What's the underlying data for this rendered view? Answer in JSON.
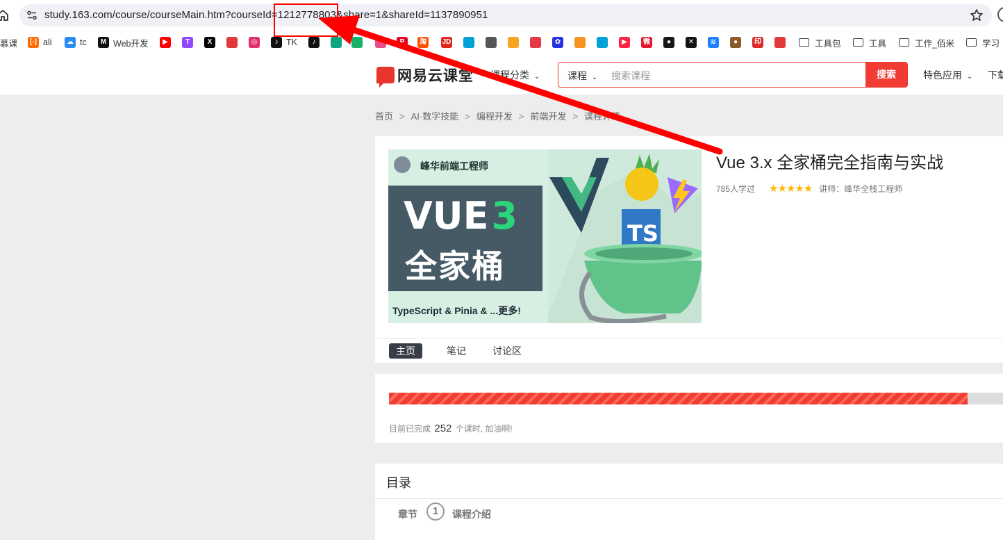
{
  "browser": {
    "url": "study.163.com/course/courseMain.htm?courseId=1212778803&share=1&shareId=1137890951",
    "bookmarks": [
      {
        "label": "慕课",
        "icon": "mooc-icon",
        "color": "#ffffff"
      },
      {
        "label": "ali",
        "icon": "aliyun-icon",
        "color": "#ff6a00"
      },
      {
        "label": "tc",
        "icon": "tencent-cloud-icon",
        "color": "#2a8cf2"
      },
      {
        "label": "Web开发",
        "icon": "mdn-icon",
        "color": "#111111"
      },
      {
        "label": "",
        "icon": "youtube-icon",
        "color": "#ff0000"
      },
      {
        "label": "",
        "icon": "twitch-icon",
        "color": "#9146ff"
      },
      {
        "label": "",
        "icon": "x-icon",
        "color": "#000000"
      },
      {
        "label": "",
        "icon": "bookmark-red-icon",
        "color": "#e03a3a"
      },
      {
        "label": "",
        "icon": "instagram-icon",
        "color": "#e1306c"
      },
      {
        "label": "TK",
        "icon": "tiktok-icon",
        "color": "#111111"
      },
      {
        "label": "",
        "icon": "tiktok-icon",
        "color": "#111111"
      },
      {
        "label": "",
        "icon": "chatgpt-icon",
        "color": "#10a37f"
      },
      {
        "label": "",
        "icon": "green-app-icon",
        "color": "#17b26a"
      },
      {
        "label": "",
        "icon": "dribbble-icon",
        "color": "#ea4c89"
      },
      {
        "label": "",
        "icon": "pinterest-icon",
        "color": "#e60023"
      },
      {
        "label": "",
        "icon": "taobao-icon",
        "color": "#ff5000"
      },
      {
        "label": "",
        "icon": "jd-icon",
        "color": "#e1251b"
      },
      {
        "label": "",
        "icon": "bilibili-icon",
        "color": "#00a1d6"
      },
      {
        "label": "",
        "icon": "bird-icon",
        "color": "#555555"
      },
      {
        "label": "",
        "icon": "smile-icon",
        "color": "#f5a623"
      },
      {
        "label": "",
        "icon": "red-logo-icon",
        "color": "#e63946"
      },
      {
        "label": "",
        "icon": "baidu-icon",
        "color": "#2932e1"
      },
      {
        "label": "",
        "icon": "orange-app-icon",
        "color": "#f7931e"
      },
      {
        "label": "",
        "icon": "bilibili-icon",
        "color": "#00a1d6"
      },
      {
        "label": "",
        "icon": "play-icon",
        "color": "#ff2442"
      },
      {
        "label": "",
        "icon": "weibo-icon",
        "color": "#e6162d"
      },
      {
        "label": "",
        "icon": "github-icon",
        "color": "#181717"
      },
      {
        "label": "",
        "icon": "close-circle-icon",
        "color": "#111111"
      },
      {
        "label": "",
        "icon": "layers-icon",
        "color": "#1e80ff"
      },
      {
        "label": "",
        "icon": "acorn-icon",
        "color": "#8b5a2b"
      },
      {
        "label": "",
        "icon": "seal-icon",
        "color": "#d92b2b"
      },
      {
        "label": "",
        "icon": "red-badge-icon",
        "color": "#e03a3a"
      },
      {
        "label": "工具包",
        "icon": "folder-icon",
        "color": "#444444"
      },
      {
        "label": "工具",
        "icon": "folder-icon",
        "color": "#444444"
      },
      {
        "label": "工作_佰米",
        "icon": "folder-icon",
        "color": "#444444"
      },
      {
        "label": "学习",
        "icon": "folder-icon",
        "color": "#444444"
      }
    ]
  },
  "header": {
    "logo_text": "网易云课堂",
    "category_label": "课程分类",
    "search_type": "课程",
    "search_placeholder": "搜索课程",
    "search_button": "搜索",
    "feature_label": "特色应用",
    "download_label": "下载"
  },
  "breadcrumb": [
    "首页",
    "AI·数字技能",
    "编程开发",
    "前端开发",
    "课程详情"
  ],
  "course": {
    "title": "Vue 3.x 全家桶完全指南与实战",
    "learners": "785人学过",
    "rating": 5,
    "teacher": "讲师：峰华全栈工程师",
    "cover": {
      "author": "峰华前端工程师",
      "big_text_1": "VUE",
      "big_text_num": "3",
      "big_text_2": "全家桶",
      "footer": "TypeScript & Pinia & ...更多!",
      "ts_badge": "TS"
    }
  },
  "tabs": [
    {
      "label": "主页",
      "active": true
    },
    {
      "label": "笔记",
      "active": false
    },
    {
      "label": "讨论区",
      "active": false
    }
  ],
  "progress": {
    "fraction": 0.936,
    "prefix": "目前已完成",
    "count": "252",
    "suffix": "个课时, 加油啊!"
  },
  "catalog": {
    "title": "目录",
    "chapter_label": "章节",
    "chapter_number": "1",
    "chapter_title": "课程介绍"
  },
  "colors": {
    "brand": "#e8362c",
    "highlight_box": "#ff0000",
    "arrow": "#ff0000"
  }
}
